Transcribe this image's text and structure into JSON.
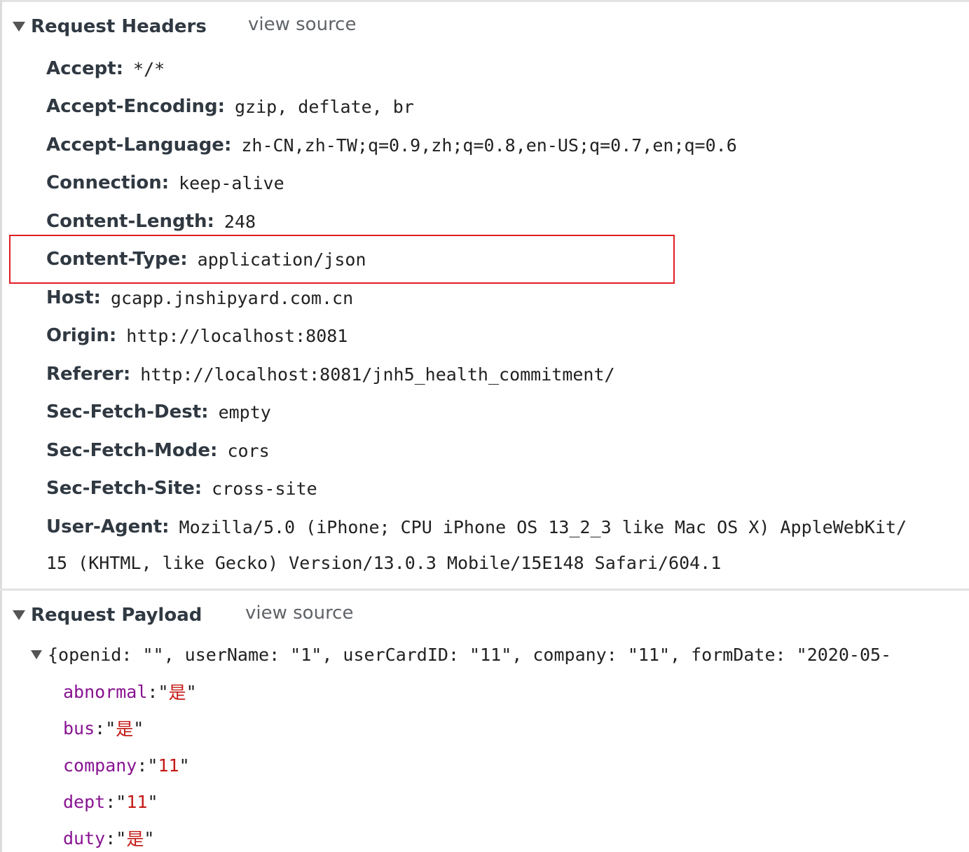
{
  "request_headers": {
    "title": "Request Headers",
    "view_source": "view source",
    "headers": [
      {
        "name": "Accept:",
        "value": "*/*"
      },
      {
        "name": "Accept-Encoding:",
        "value": "gzip, deflate, br"
      },
      {
        "name": "Accept-Language:",
        "value": "zh-CN,zh-TW;q=0.9,zh;q=0.8,en-US;q=0.7,en;q=0.6"
      },
      {
        "name": "Connection:",
        "value": "keep-alive"
      },
      {
        "name": "Content-Length:",
        "value": "248"
      },
      {
        "name": "Content-Type:",
        "value": "application/json"
      },
      {
        "name": "Host:",
        "value": "gcapp.jnshipyard.com.cn"
      },
      {
        "name": "Origin:",
        "value": "http://localhost:8081"
      },
      {
        "name": "Referer:",
        "value": "http://localhost:8081/jnh5_health_commitment/"
      },
      {
        "name": "Sec-Fetch-Dest:",
        "value": "empty"
      },
      {
        "name": "Sec-Fetch-Mode:",
        "value": "cors"
      },
      {
        "name": "Sec-Fetch-Site:",
        "value": "cross-site"
      },
      {
        "name": "User-Agent:",
        "value": "Mozilla/5.0 (iPhone; CPU iPhone OS 13_2_3 like Mac OS X) AppleWebKit/"
      }
    ],
    "user_agent_continuation": "15 (KHTML, like Gecko) Version/13.0.3 Mobile/15E148 Safari/604.1",
    "highlighted_header": "Content-Type:"
  },
  "request_payload": {
    "title": "Request Payload",
    "view_source": "view source",
    "summary": "{openid: \"\", userName: \"1\", userCardID: \"11\", company: \"11\", formDate: \"2020-05-",
    "properties": [
      {
        "key": "abnormal",
        "value": "是"
      },
      {
        "key": "bus",
        "value": "是"
      },
      {
        "key": "company",
        "value": "11"
      },
      {
        "key": "dept",
        "value": "11"
      },
      {
        "key": "duty",
        "value": "是"
      }
    ]
  }
}
